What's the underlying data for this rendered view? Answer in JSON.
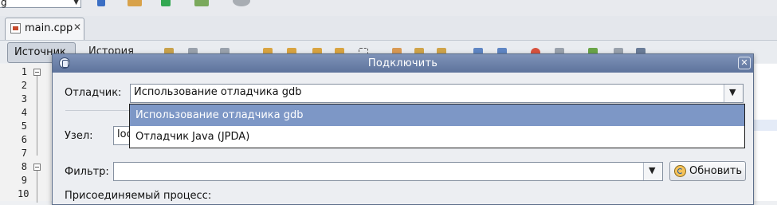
{
  "ide": {
    "top_combo_value": "g",
    "file_tab": {
      "name": "main.cpp",
      "close": "✕"
    },
    "toolbar": {
      "source_label": "Источник",
      "history_label": "История"
    },
    "line_numbers": [
      "1",
      "2",
      "3",
      "4",
      "5",
      "6",
      "7",
      "8",
      "9",
      "10"
    ]
  },
  "dialog": {
    "title": "Подключить",
    "close": "✕",
    "debugger": {
      "label": "Отладчик:",
      "value": "Использование отладчика gdb"
    },
    "debugger_options": [
      "Использование отладчика gdb",
      "Отладчик Java (JPDA)"
    ],
    "host": {
      "label": "Узел:",
      "value": "loc"
    },
    "filter": {
      "label": "Фильтр:",
      "value": ""
    },
    "refresh_label": "Обновить",
    "process_label": "Присоединяемый процесс:"
  },
  "colors": {
    "titlebar": "#6a7fa8",
    "selected_option": "#7d97c6"
  },
  "icons": [
    "file-cpp-icon",
    "app-icon",
    "close-icon",
    "chevron-down-icon",
    "refresh-icon",
    "fold-icon"
  ]
}
